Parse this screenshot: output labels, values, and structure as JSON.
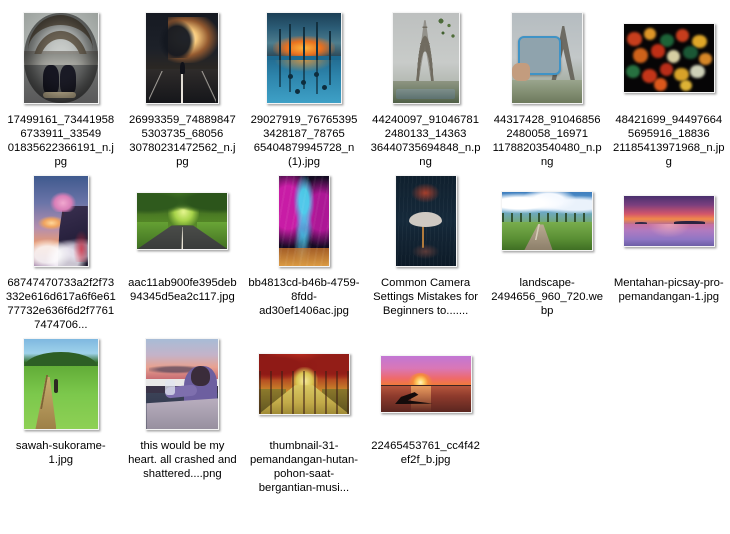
{
  "view": {
    "name": "file-explorer-thumbnail-grid",
    "background": "#ffffff",
    "columns": 6,
    "item_count": 16
  },
  "items": [
    {
      "filename": "17499161_734419586733911_3354901835622366191_n.jpg",
      "label": "17499161_734419586733911_33549\n01835622366191_n.jpg",
      "thumb": "fisheye-eiffel-tower-shoes",
      "orientation": "portrait"
    },
    {
      "filename": "26993359_748898475303735_6805630780231472562_n.jpg",
      "label": "26993359_748898475303735_68056\n30780231472562_n.jpg",
      "thumb": "dark-road-light-burst",
      "orientation": "portrait"
    },
    {
      "filename": "29027919_767653953428187_7876565404879945728_n (1).jpg",
      "label": "29027919_767653953428187_78765\n65404879945728_n (1).jpg",
      "thumb": "sunset-lake-reflection-poles",
      "orientation": "portrait"
    },
    {
      "filename": "44240097_910467812480133_1436336440735694848_n.png",
      "label": "44240097_910467812480133_14363\n36440735694848_n.png",
      "thumb": "eiffel-tower-overcast",
      "orientation": "portrait"
    },
    {
      "filename": "44317428_910468562480058_1697111788203540480_n.png",
      "label": "44317428_910468562480058_16971\n11788203540480_n.png",
      "thumb": "hand-holding-card-eiffel",
      "orientation": "portrait"
    },
    {
      "filename": "48421699_944976645695916_1883621185413971968_n.jpg",
      "label": "48421699_944976645695916_18836\n21185413971968_n.jpg",
      "thumb": "bokeh-christmas-lights",
      "orientation": "landscape"
    },
    {
      "filename": "68747470733a2f2f73332e616d617a6f6e6177732e636f6d2f77617474706...",
      "label": "68747470733a2f2f73332e616d617a6f6e6177732e636f6d2f77617474706...",
      "thumb": "fantasy-cliff-tree-sunset",
      "orientation": "portrait"
    },
    {
      "filename": "aac11ab900fe395deb94345d5ea2c117.jpg",
      "label": "aac11ab900fe395deb94345d5ea2c117.jpg",
      "thumb": "green-tree-tunnel-road",
      "orientation": "landscape"
    },
    {
      "filename": "bb4813cd-b46b-4759-8fdd-ad30ef1406ac.jpg",
      "label": "bb4813cd-b46b-4759-8fdd-ad30ef1406ac.jpg",
      "thumb": "neon-magenta-cyan-forest",
      "orientation": "portrait"
    },
    {
      "filename": "Common Camera Settings Mistakes for Beginners to.......",
      "label": "Common Camera Settings Mistakes for Beginners to.......",
      "thumb": "umbrella-on-dark-water",
      "orientation": "portrait"
    },
    {
      "filename": "landscape-2494656_960_720.webp",
      "label": "landscape-2494656_960_720.webp",
      "thumb": "boardwalk-marsh-blue-sky",
      "orientation": "landscape"
    },
    {
      "filename": "Mentahan-picsay-pro-pemandangan-1.jpg",
      "label": "Mentahan-picsay-pro-pemandangan-1.jpg",
      "thumb": "purple-pink-sea-sunset",
      "orientation": "landscape"
    },
    {
      "filename": "sawah-sukorame-1.jpg",
      "label": "sawah-sukorame-1.jpg",
      "thumb": "green-rice-field-path",
      "orientation": "portrait"
    },
    {
      "filename": "this would be my heart. all crashed and shattered....png",
      "label": "this would be my heart. all crashed and shattered....png",
      "thumb": "person-balcony-dusk",
      "orientation": "portrait"
    },
    {
      "filename": "thumbnail-31-pemandangan-hutan-pohon-saat-bergantian-musi...",
      "label": "thumbnail-31-pemandangan-hutan-pohon-saat-bergantian-musi...",
      "thumb": "red-autumn-tree-tunnel",
      "orientation": "landscape"
    },
    {
      "filename": "22465453761_cc4f42ef2f_b.jpg",
      "label": "22465453761_cc4f42ef2f_b.jpg",
      "thumb": "sunset-boat-silhouette",
      "orientation": "landscape"
    }
  ]
}
